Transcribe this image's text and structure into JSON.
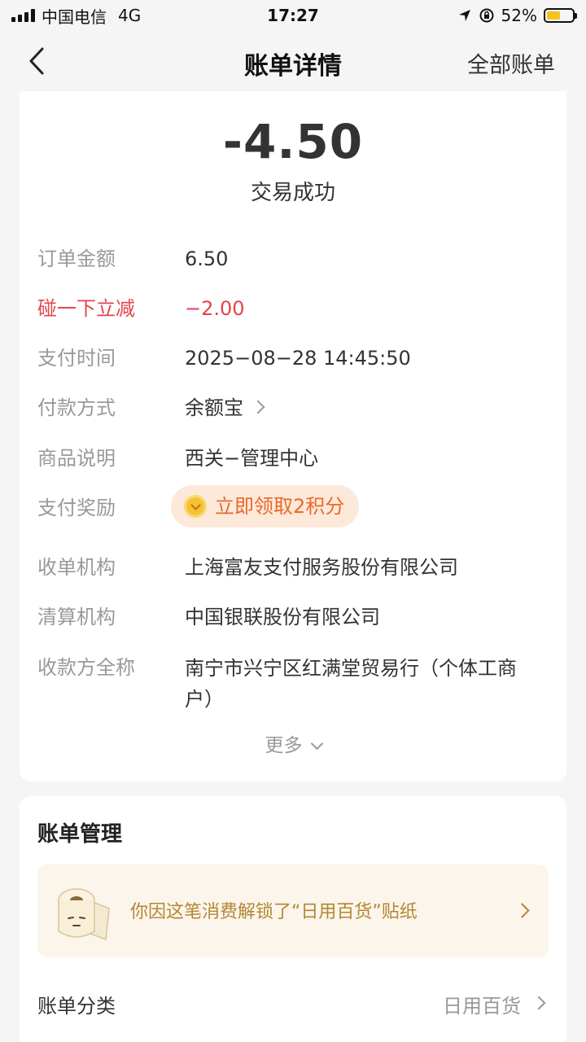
{
  "status_bar": {
    "carrier": "中国电信",
    "network": "4G",
    "time": "17:27",
    "battery": "52%",
    "battery_level": 0.52
  },
  "nav": {
    "title": "账单详情",
    "right_link": "全部账单"
  },
  "summary": {
    "amount": "-4.50",
    "status": "交易成功"
  },
  "details": {
    "order_amount_label": "订单金额",
    "order_amount_value": "6.50",
    "discount_label": "碰一下立减",
    "discount_value": "−2.00",
    "pay_time_label": "支付时间",
    "pay_time_value": "2025−08−28 14:45:50",
    "pay_method_label": "付款方式",
    "pay_method_value": "余额宝",
    "product_label": "商品说明",
    "product_value": "西关−管理中心",
    "reward_label": "支付奖励",
    "reward_value": "立即领取2积分",
    "acquirer_label": "收单机构",
    "acquirer_value": "上海富友支付服务股份有限公司",
    "clearing_label": "清算机构",
    "clearing_value": "中国银联股份有限公司",
    "payee_label": "收款方全称",
    "payee_value": "南宁市兴宁区红满堂贸易行（个体工商户）",
    "more": "更多"
  },
  "management": {
    "title": "账单管理",
    "sticker_text": "你因这笔消费解锁了“日用百货”贴纸",
    "category_label": "账单分类",
    "category_value": "日用百货"
  },
  "colors": {
    "discount_red": "#e2454d",
    "reward_orange": "#e9692c",
    "reward_bg": "#fde9d9",
    "banner_bg": "#fbf5eb",
    "banner_text": "#b38733",
    "battery_yellow": "#f4c21e"
  }
}
